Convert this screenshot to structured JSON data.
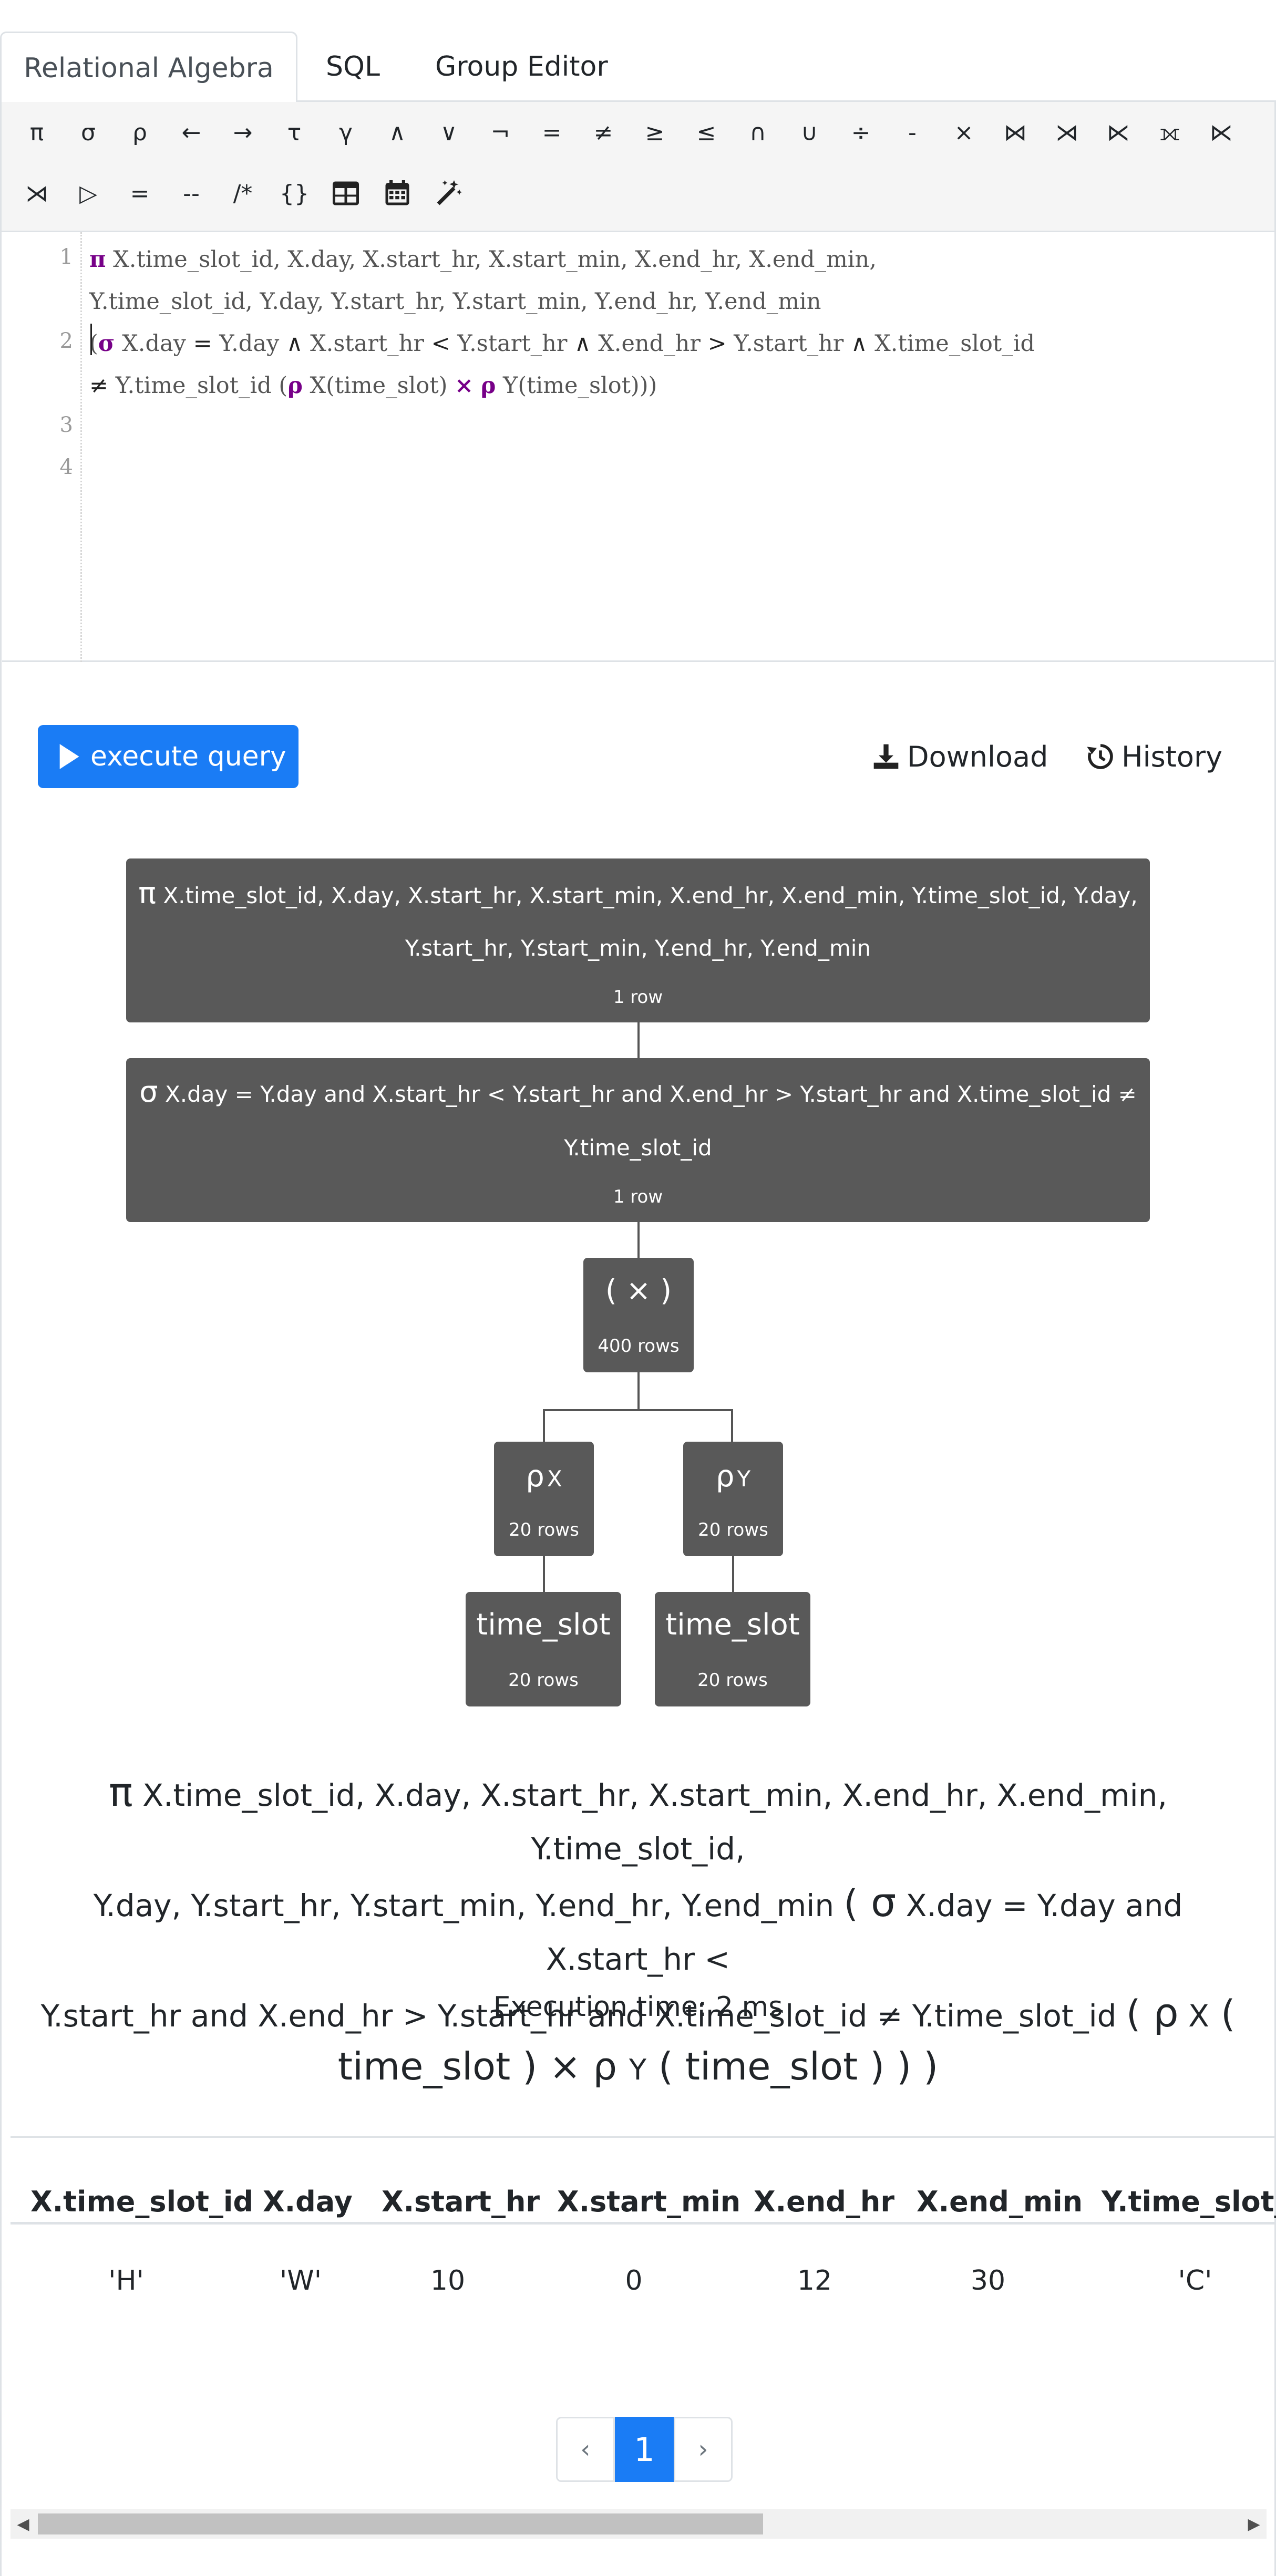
{
  "tabs": [
    {
      "label": "Relational Algebra",
      "active": true
    },
    {
      "label": "SQL",
      "active": false
    },
    {
      "label": "Group Editor",
      "active": false
    }
  ],
  "toolbar": {
    "row1": [
      "π",
      "σ",
      "ρ",
      "←",
      "→",
      "τ",
      "γ",
      "∧",
      "∨",
      "¬",
      "=",
      "≠",
      "≥",
      "≤",
      "∩",
      "∪",
      "÷",
      "-",
      "×",
      "⋈",
      "⋊",
      "⋉",
      "⟗",
      "⋉"
    ],
    "row2": [
      "⋊",
      "▷",
      "=",
      "--",
      "/*",
      "{}"
    ],
    "icon_buttons": [
      "table-icon",
      "calendar-icon",
      "magic-wand-icon"
    ]
  },
  "editor": {
    "line_numbers": [
      "1",
      "2",
      "3",
      "4"
    ],
    "line1_kw": "π",
    "line1_a": " X.time_slot_id, X.day, X.start_hr, X.start_min, X.end_hr, X.end_min,",
    "line1_b": "Y.time_slot_id, Y.day, Y.start_hr, Y.start_min, Y.end_hr, Y.end_min",
    "line2_a1": "(",
    "line2_kw_sigma": "σ",
    "line2_a2": " X.day ",
    "line2_op1": "=",
    "line2_a3": " Y.day ",
    "line2_op2": "∧",
    "line2_a4": " X.start_hr ",
    "line2_op3": "<",
    "line2_a5": " Y.start_hr ",
    "line2_op4": "∧",
    "line2_a6": " X.end_hr ",
    "line2_op5": ">",
    "line2_a7": " Y.start_hr ",
    "line2_op6": "∧",
    "line2_a8": " X.time_slot_id",
    "line2_b1": "≠",
    "line2_b2": " Y.time_slot_id (",
    "line2_kw_rho1": "ρ",
    "line2_b3": " X(time_slot) ",
    "line2_kw_cross": "×",
    "line2_b4": " ",
    "line2_kw_rho2": "ρ",
    "line2_b5": " Y(time_slot)))"
  },
  "actions": {
    "execute_label": "execute query",
    "download_label": "Download",
    "history_label": "History"
  },
  "tree": {
    "projection": {
      "symbol": "π",
      "line1": "X.time_slot_id, X.day, X.start_hr, X.start_min, X.end_hr, X.end_min, Y.time_slot_id, Y.day,",
      "line2": "Y.start_hr, Y.start_min, Y.end_hr, Y.end_min",
      "rows": "1 row"
    },
    "selection": {
      "symbol": "σ",
      "line1": "X.day = Y.day and X.start_hr < Y.start_hr and X.end_hr > Y.start_hr and X.time_slot_id ≠",
      "line2": "Y.time_slot_id",
      "rows": "1 row"
    },
    "cross": {
      "label": "( × )",
      "rows": "400 rows"
    },
    "rename_x": {
      "symbol": "ρ",
      "sub": "X",
      "rows": "20 rows"
    },
    "rename_y": {
      "symbol": "ρ",
      "sub": "Y",
      "rows": "20 rows"
    },
    "rel_left": {
      "name": "time_slot",
      "rows": "20 rows"
    },
    "rel_right": {
      "name": "time_slot",
      "rows": "20 rows"
    }
  },
  "formula": {
    "pi": "π",
    "attrs1": " X.time_slot_id, X.day, X.start_hr, X.start_min, X.end_hr, X.end_min, Y.time_slot_id,",
    "attrs2": "Y.day, Y.start_hr, Y.start_min, Y.end_hr, Y.end_min ",
    "paren1": "(",
    "sigma": " σ",
    "cond1": " X.day = Y.day and X.start_hr <",
    "cond2": "Y.start_hr and X.end_hr > Y.start_hr and X.time_slot_id ≠ Y.time_slot_id ",
    "paren2": "(",
    "rho1": " ρ",
    "x": " X",
    "paren3": " (",
    "rel1": "time_slot ) × ρ ",
    "y": "Y",
    "rel2": " ( time_slot ) ) )"
  },
  "execution_time": "Execution time: 2 ms",
  "table": {
    "headers": [
      "X.time_slot_id",
      "X.day",
      "X.start_hr",
      "X.start_min",
      "X.end_hr",
      "X.end_min",
      "Y.time_slot_i"
    ],
    "rows": [
      [
        "'H'",
        "'W'",
        "10",
        "0",
        "12",
        "30",
        "'C'"
      ]
    ]
  },
  "pagination": {
    "prev": "‹",
    "current": "1",
    "next": "›"
  },
  "colors": {
    "primary": "#1a7cf5",
    "node": "#595959",
    "keyword": "#770088"
  }
}
